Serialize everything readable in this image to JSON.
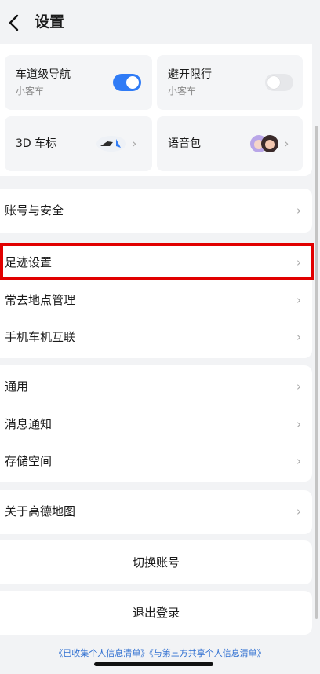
{
  "header": {
    "title": "设置"
  },
  "quick": {
    "lane_nav": {
      "label": "车道级导航",
      "sub": "小客车",
      "on": true
    },
    "avoid_limit": {
      "label": "避开限行",
      "sub": "小客车",
      "on": false
    },
    "car_icon": {
      "label": "3D 车标"
    },
    "voice_pack": {
      "label": "语音包"
    }
  },
  "list": {
    "account_security": "账号与安全",
    "footprint": "足迹设置",
    "frequent_places": "常去地点管理",
    "phone_car": "手机车机互联",
    "general": "通用",
    "notifications": "消息通知",
    "storage": "存储空间",
    "about": "关于高德地图",
    "arrow": "›"
  },
  "actions": {
    "switch_account": "切换账号",
    "logout": "退出登录"
  },
  "footer": {
    "links": "《已收集个人信息清单》《与第三方共享个人信息清单》"
  },
  "colors": {
    "accent": "#2f7bf6",
    "highlight": "#e10000",
    "background": "#f2f3f5"
  }
}
